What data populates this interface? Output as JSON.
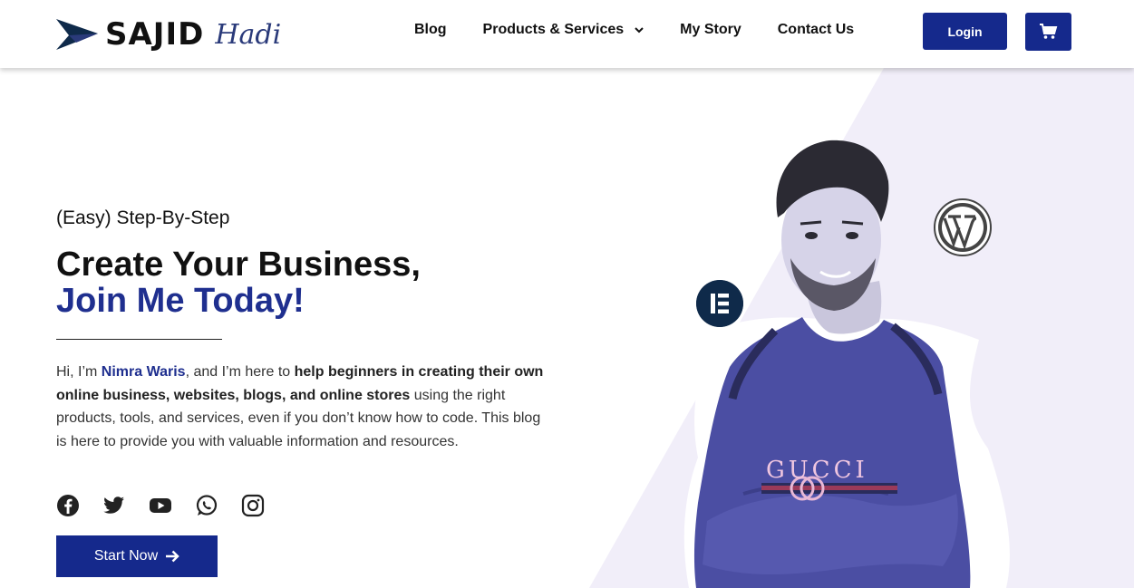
{
  "header": {
    "logo": {
      "word": "SAJID",
      "script": "Hadi"
    },
    "nav": [
      {
        "label": "Blog"
      },
      {
        "label": "Products & Services",
        "has_dropdown": true
      },
      {
        "label": "My Story"
      },
      {
        "label": "Contact Us"
      }
    ],
    "login_label": "Login",
    "cart_icon": "cart-icon"
  },
  "hero": {
    "eyebrow": "(Easy) Step-By-Step",
    "headline": "Create Your Business,",
    "headline_accent": "Join Me Today!",
    "intro": {
      "p1": "Hi, I’m ",
      "name": "Nimra Waris",
      "p2": ", and I’m here to ",
      "bold": "help beginners in creating their own online business, websites, blogs, and online stores",
      "p3": " using the right products, tools, and services, even if you don’t know how to code. This blog is here to provide you with valuable information and resources."
    },
    "socials": [
      "facebook-icon",
      "twitter-icon",
      "youtube-icon",
      "whatsapp-icon",
      "instagram-icon"
    ],
    "cta_label": "Start Now",
    "person_sweater_text": "GUCCI"
  },
  "colors": {
    "brand": "#15298c",
    "accent_text": "#1f2f8f",
    "hero_tint": "#f1eef9"
  }
}
